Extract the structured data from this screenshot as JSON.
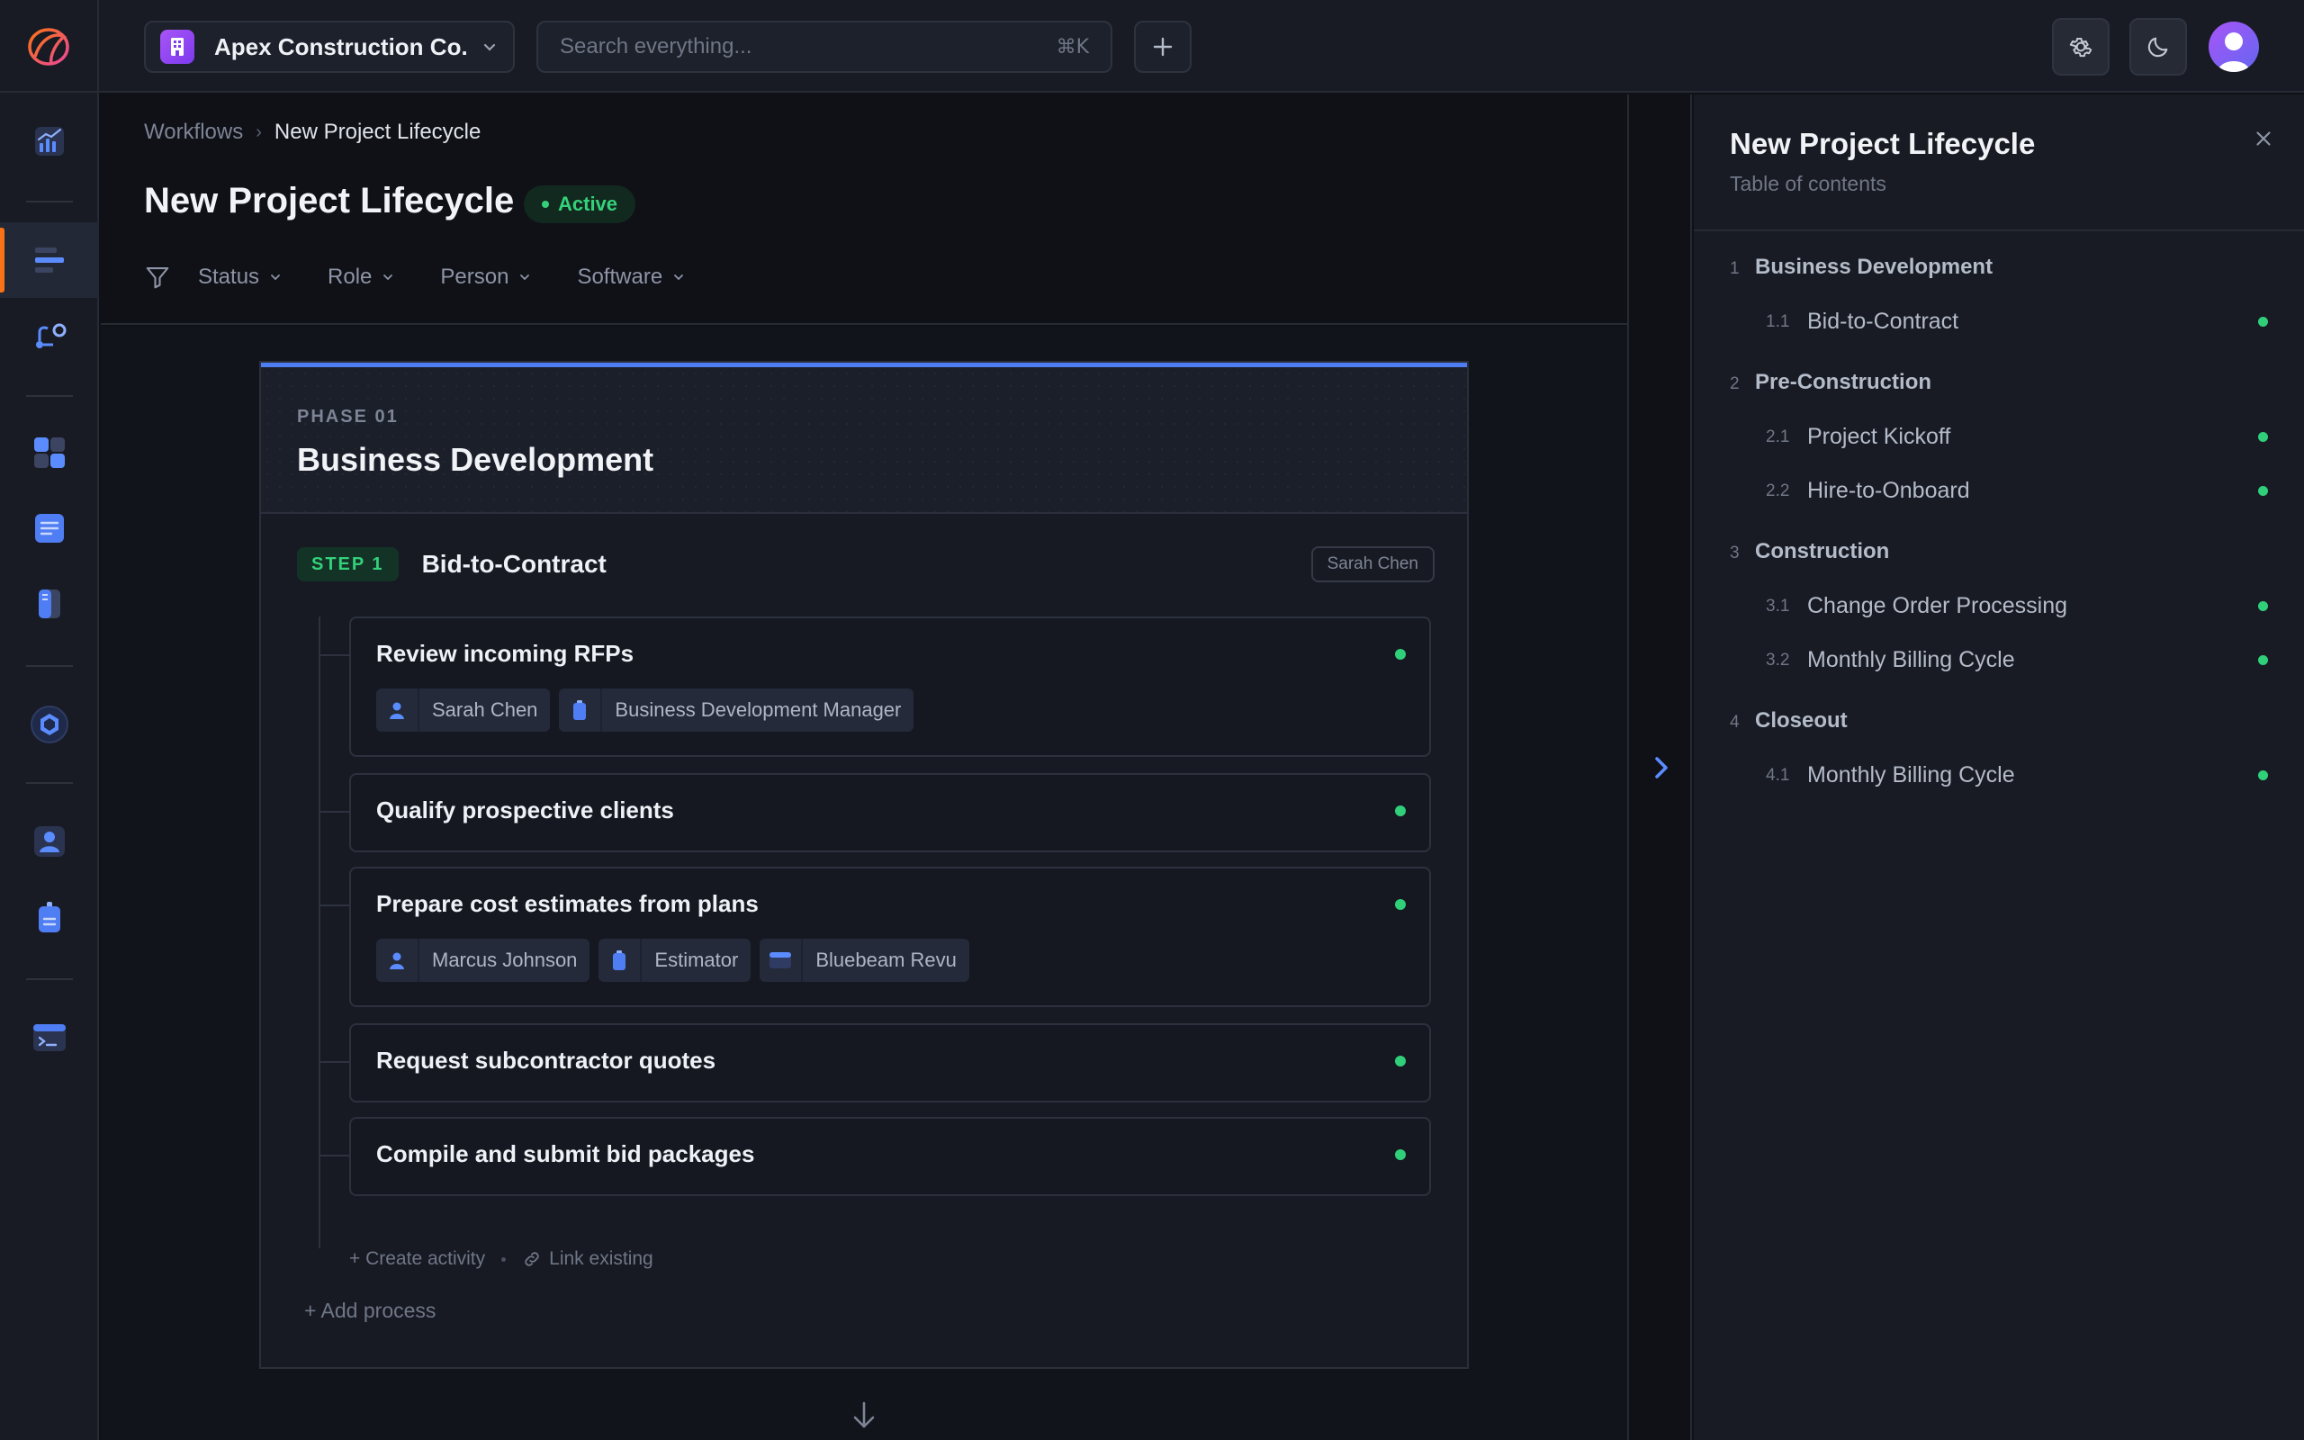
{
  "colors": {
    "accent": "#4f7df3",
    "status_active": "#34d17a",
    "brand_orange": "#f97316",
    "company_purple": "#a855f7"
  },
  "topbar": {
    "company_name": "Apex Construction Co.",
    "search_placeholder": "Search everything...",
    "search_shortcut": "⌘K"
  },
  "breadcrumb": {
    "parent": "Workflows",
    "separator": "›",
    "current": "New Project Lifecycle"
  },
  "page": {
    "title": "New Project Lifecycle",
    "status": "Active"
  },
  "filters": [
    "Status",
    "Role",
    "Person",
    "Software"
  ],
  "phase": {
    "label": "PHASE 01",
    "title": "Business Development",
    "step": {
      "badge": "STEP 1",
      "title": "Bid-to-Contract",
      "owner": "Sarah Chen"
    },
    "activities": [
      {
        "title": "Review incoming RFPs",
        "tags": [
          {
            "icon": "person-icon",
            "label": "Sarah Chen"
          },
          {
            "icon": "badge-icon",
            "label": "Business Development Manager"
          }
        ]
      },
      {
        "title": "Qualify prospective clients",
        "tags": []
      },
      {
        "title": "Prepare cost estimates from plans",
        "tags": [
          {
            "icon": "person-icon",
            "label": "Marcus Johnson"
          },
          {
            "icon": "badge-icon",
            "label": "Estimator"
          },
          {
            "icon": "window-icon",
            "label": "Bluebeam Revu"
          }
        ]
      },
      {
        "title": "Request subcontractor quotes",
        "tags": []
      },
      {
        "title": "Compile and submit bid packages",
        "tags": []
      }
    ],
    "create_activity": "+ Create activity",
    "link_existing": "Link existing",
    "add_process": "+ Add process"
  },
  "toc": {
    "title": "New Project Lifecycle",
    "subtitle": "Table of contents",
    "sections": [
      {
        "num": "1",
        "label": "Business Development",
        "items": [
          {
            "num": "1.1",
            "label": "Bid-to-Contract"
          }
        ]
      },
      {
        "num": "2",
        "label": "Pre-Construction",
        "items": [
          {
            "num": "2.1",
            "label": "Project Kickoff"
          },
          {
            "num": "2.2",
            "label": "Hire-to-Onboard"
          }
        ]
      },
      {
        "num": "3",
        "label": "Construction",
        "items": [
          {
            "num": "3.1",
            "label": "Change Order Processing"
          },
          {
            "num": "3.2",
            "label": "Monthly Billing Cycle"
          }
        ]
      },
      {
        "num": "4",
        "label": "Closeout",
        "items": [
          {
            "num": "4.1",
            "label": "Monthly Billing Cycle"
          }
        ]
      }
    ]
  }
}
